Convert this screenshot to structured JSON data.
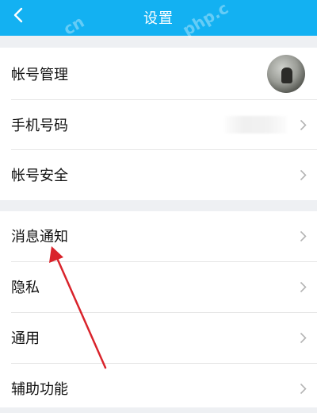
{
  "header": {
    "title": "设置",
    "back_icon": "chevron-left-icon",
    "background": "#13b1f2",
    "watermark_left": "cn",
    "watermark_right": "php.c"
  },
  "sections": [
    {
      "items": [
        {
          "label": "帐号管理",
          "trailing": "avatar"
        },
        {
          "label": "手机号码",
          "trailing": "chevron-right-icon"
        },
        {
          "label": "帐号安全",
          "trailing": "chevron-right-icon"
        }
      ]
    },
    {
      "items": [
        {
          "label": "消息通知",
          "trailing": "chevron-right-icon"
        },
        {
          "label": "隐私",
          "trailing": "chevron-right-icon"
        },
        {
          "label": "通用",
          "trailing": "chevron-right-icon"
        },
        {
          "label": "辅助功能",
          "trailing": "chevron-right-icon"
        }
      ]
    }
  ],
  "annotation": {
    "arrow_color": "#d9232b",
    "points_to": "消息通知"
  }
}
